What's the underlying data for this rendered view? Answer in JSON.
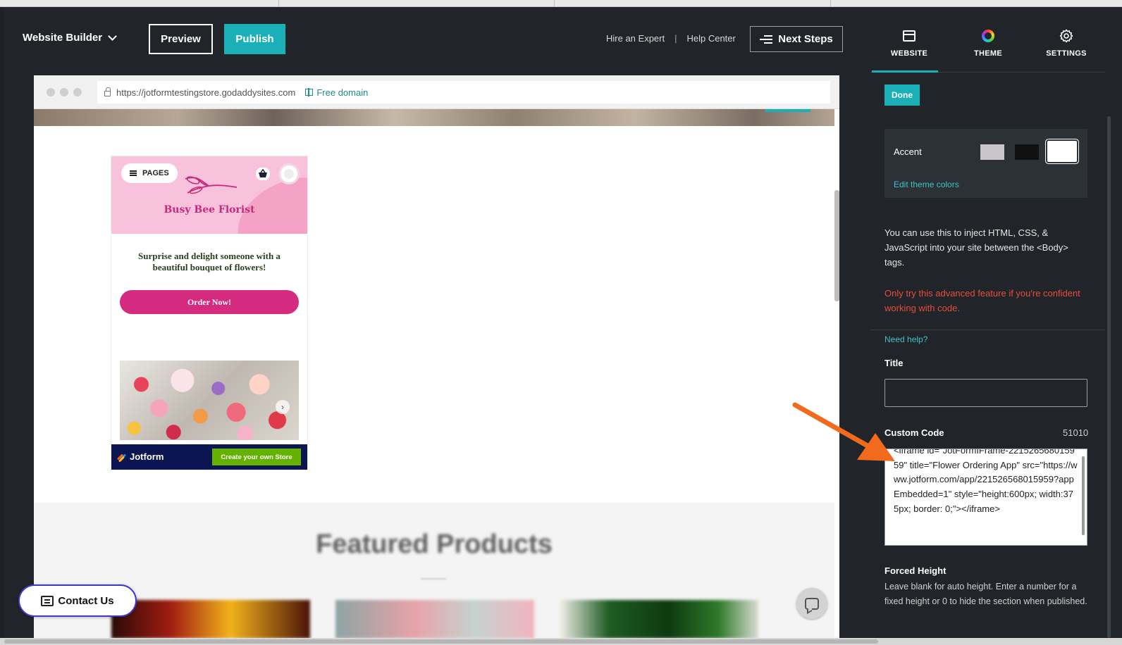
{
  "header": {
    "brand": "Website Builder",
    "preview_label": "Preview",
    "publish_label": "Publish",
    "hire_expert": "Hire an Expert",
    "separator": "|",
    "help_center": "Help Center",
    "next_steps": "Next Steps"
  },
  "browser": {
    "url": "https://jotformtestingstore.godaddysites.com",
    "free_domain": "Free domain"
  },
  "app": {
    "pages_label": "PAGES",
    "title": "Busy Bee Florist",
    "tagline": "Surprise and delight someone with a beautiful bouquet of flowers!",
    "order_button": "Order Now!",
    "next_arrow": "›",
    "jotform_label": "Jotform",
    "create_store": "Create your own Store"
  },
  "site": {
    "featured_heading": "Featured Products",
    "contact_us": "Contact Us"
  },
  "panel": {
    "tabs": [
      {
        "label": "WEBSITE",
        "icon": "browser-window-icon"
      },
      {
        "label": "THEME",
        "icon": "color-wheel-icon"
      },
      {
        "label": "SETTINGS",
        "icon": "gear-icon"
      }
    ],
    "done_label": "Done",
    "accent_label": "Accent",
    "accent_colors": [
      "#c9c4c9",
      "#111111",
      "#ffffff"
    ],
    "edit_theme_colors": "Edit theme colors",
    "inject_description": "You can use this to inject HTML, CSS, & JavaScript into your site between the <Body> tags.",
    "warning": "Only try this advanced feature if you're confident working with code.",
    "need_help": "Need help?",
    "title_label": "Title",
    "title_value": "",
    "custom_code_label": "Custom Code",
    "custom_code_count": "51010",
    "custom_code_value": "<iframe id=\"JotFormIFrame-221526568015959\" title=\"Flower Ordering App\" src=\"https://www.jotform.com/app/221526568015959?appEmbedded=1\" style=\"height:600px; width:375px; border: 0;\"></iframe>",
    "forced_height_label": "Forced Height",
    "forced_height_help": "Leave blank for auto height. Enter a number for a fixed height or 0 to hide the section when published."
  },
  "colors": {
    "accent_teal": "#1bb0b7",
    "editor_bg": "#212529",
    "warning_red": "#e84c3d",
    "annotation_arrow": "#f26b1d",
    "app_pink": "#d42a80",
    "jotform_navy": "#0a1551",
    "jotform_green": "#64b200"
  }
}
